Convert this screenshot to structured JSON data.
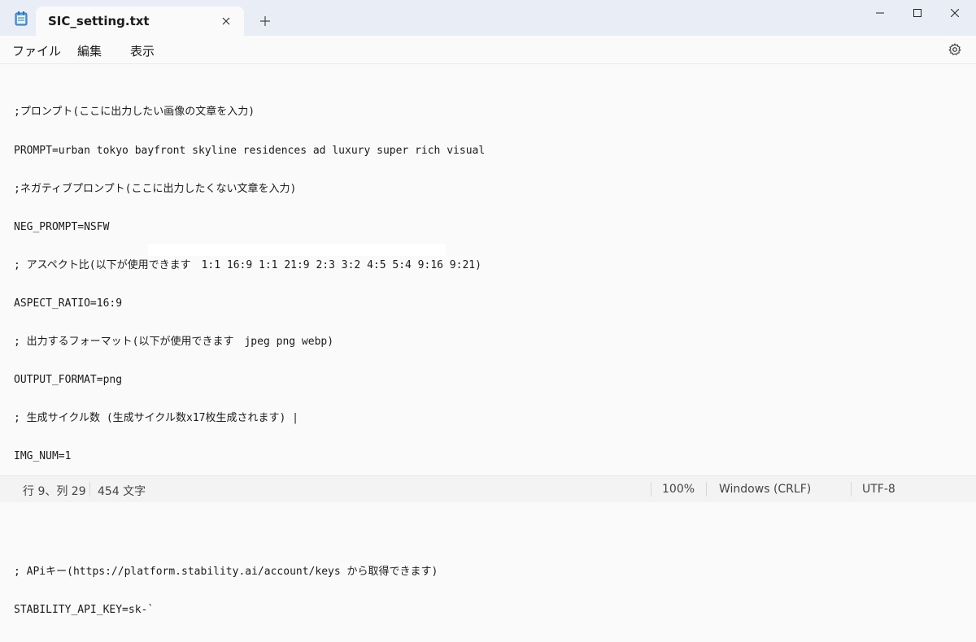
{
  "window": {
    "tab_title": "SIC_setting.txt",
    "new_tab_symbol": "+"
  },
  "menu": {
    "file": "ファイル",
    "edit": "編集",
    "view": "表示"
  },
  "editor": {
    "lines": [
      ";プロンプト(ここに出力したい画像の文章を入力)",
      "PROMPT=urban tokyo bayfront skyline residences ad luxury super rich visual",
      ";ネガティブプロンプト(ここに出力したくない文章を入力)",
      "NEG_PROMPT=NSFW",
      "; アスペクト比(以下が使用できます　1:1 16:9 1:1 21:9 2:3 3:2 4:5 5:4 9:16 9:21)",
      "ASPECT_RATIO=16:9",
      "; 出力するフォーマット(以下が使用できます　jpeg png webp)",
      "OUTPUT_FORMAT=png",
      "; 生成サイクル数 (生成サイクル数x17枚生成されます) |",
      "IMG_NUM=1",
      "",
      "",
      "; APiキー(https://platform.stability.ai/account/keys から取得できます)",
      "STABILITY_API_KEY=sk-`"
    ]
  },
  "status": {
    "position": "行 9、列 29",
    "char_count": "454 文字",
    "zoom": "100%",
    "line_ending": "Windows (CRLF)",
    "encoding": "UTF-8"
  },
  "colors": {
    "titlebar": "#e9eef6",
    "background": "#fafafa",
    "statusbar": "#f3f3f3"
  }
}
